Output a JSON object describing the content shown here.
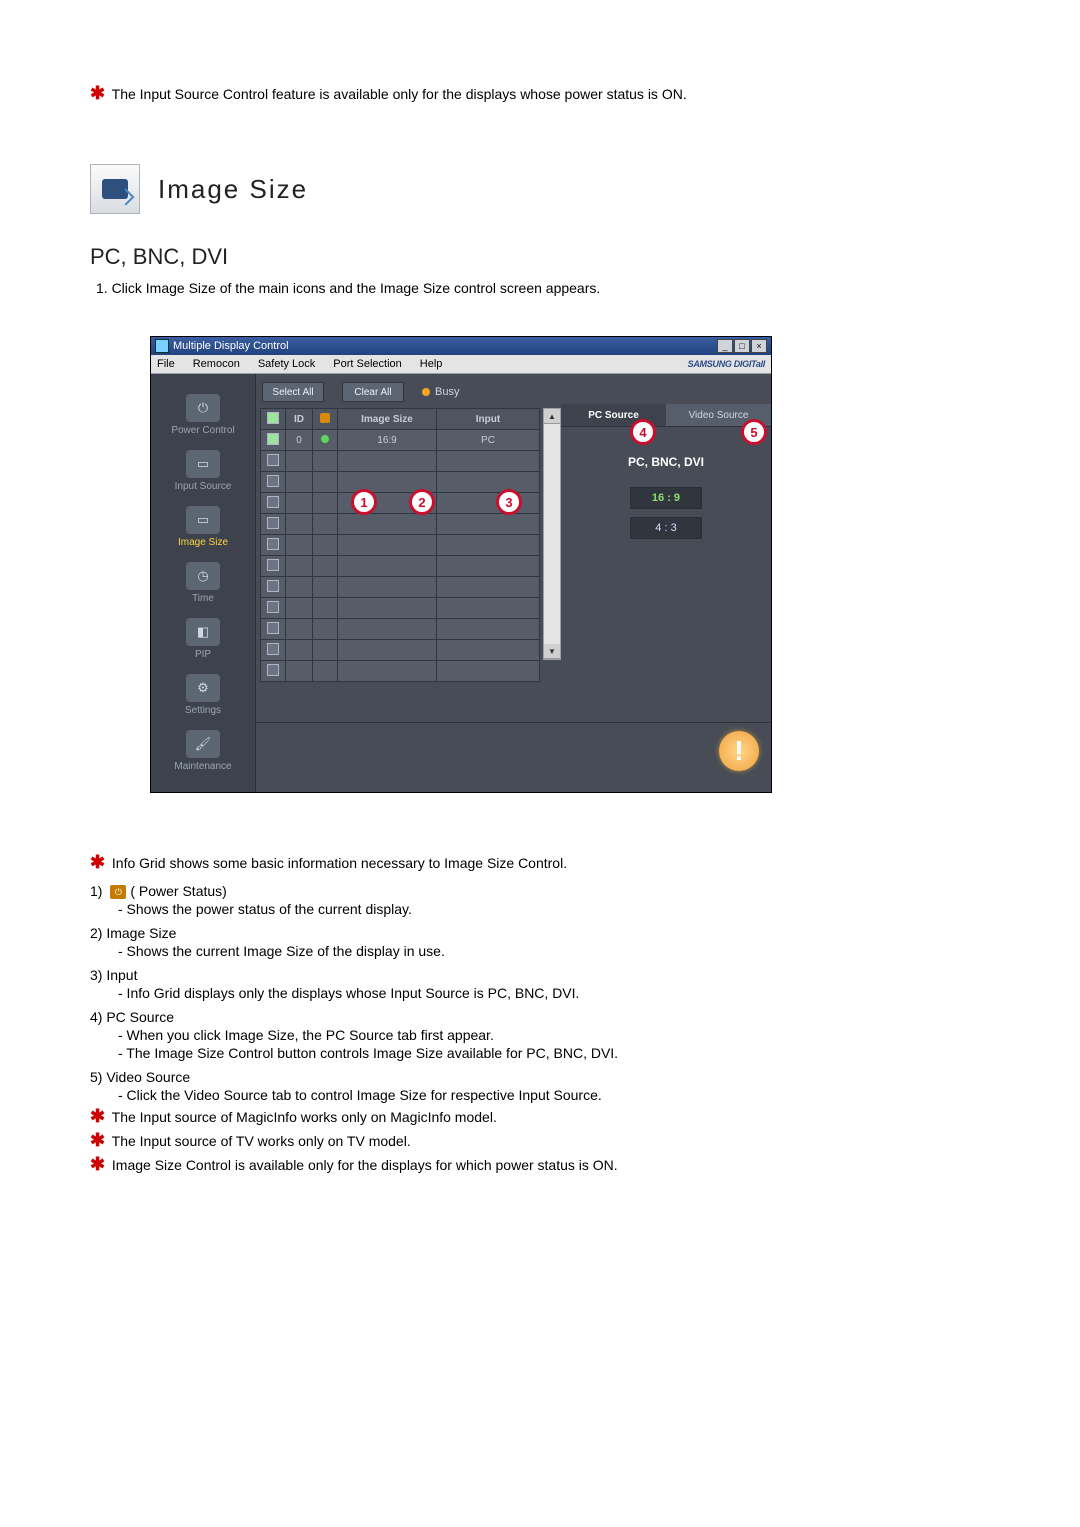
{
  "intro_note": "The Input Source Control feature is available only for the displays whose power status is ON.",
  "heading": "Image Size",
  "sub_heading": "PC, BNC, DVI",
  "step1": "1.  Click Image Size of the main icons and the Image Size control screen appears.",
  "app": {
    "title": "Multiple Display Control",
    "menus": [
      "File",
      "Remocon",
      "Safety Lock",
      "Port Selection",
      "Help"
    ],
    "brand": "SAMSUNG DIGITall",
    "sidebar": [
      {
        "label": "Power Control"
      },
      {
        "label": "Input Source"
      },
      {
        "label": "Image Size",
        "selected": true
      },
      {
        "label": "Time"
      },
      {
        "label": "PIP"
      },
      {
        "label": "Settings"
      },
      {
        "label": "Maintenance"
      }
    ],
    "toolbar": {
      "select_all": "Select All",
      "clear_all": "Clear All",
      "busy": "Busy"
    },
    "grid": {
      "headers": [
        "",
        "ID",
        "",
        "Image Size",
        "Input"
      ],
      "row0": {
        "id": "0",
        "img": "16:9",
        "input": "PC"
      }
    },
    "tabs": {
      "pc": "PC Source",
      "video": "Video Source"
    },
    "panel_title": "PC, BNC, DVI",
    "options": [
      "16 : 9",
      "4 : 3"
    ]
  },
  "legend_intro": "Info Grid shows some basic information necessary to Image Size Control.",
  "legend": [
    {
      "num": "1)",
      "title": "( Power Status)",
      "subs": [
        "- Shows the power status of the current display."
      ],
      "hasIcon": true
    },
    {
      "num": "2)",
      "title": "Image Size",
      "subs": [
        "- Shows the current Image Size of the display in use."
      ]
    },
    {
      "num": "3)",
      "title": "Input",
      "subs": [
        "- Info Grid displays only the displays whose Input Source is PC, BNC, DVI."
      ]
    },
    {
      "num": "4)",
      "title": "PC Source",
      "subs": [
        "- When you click Image Size, the PC Source tab first appear.",
        "- The Image Size Control button controls Image Size available for PC, BNC, DVI."
      ]
    },
    {
      "num": "5)",
      "title": "Video Source",
      "subs": [
        "- Click the Video Source tab to control Image Size for respective Input Source."
      ]
    }
  ],
  "end_notes": [
    "The Input source of MagicInfo works only on MagicInfo model.",
    "The Input source of TV works only on TV model.",
    "Image Size Control is available only for the displays for which power status is ON."
  ]
}
